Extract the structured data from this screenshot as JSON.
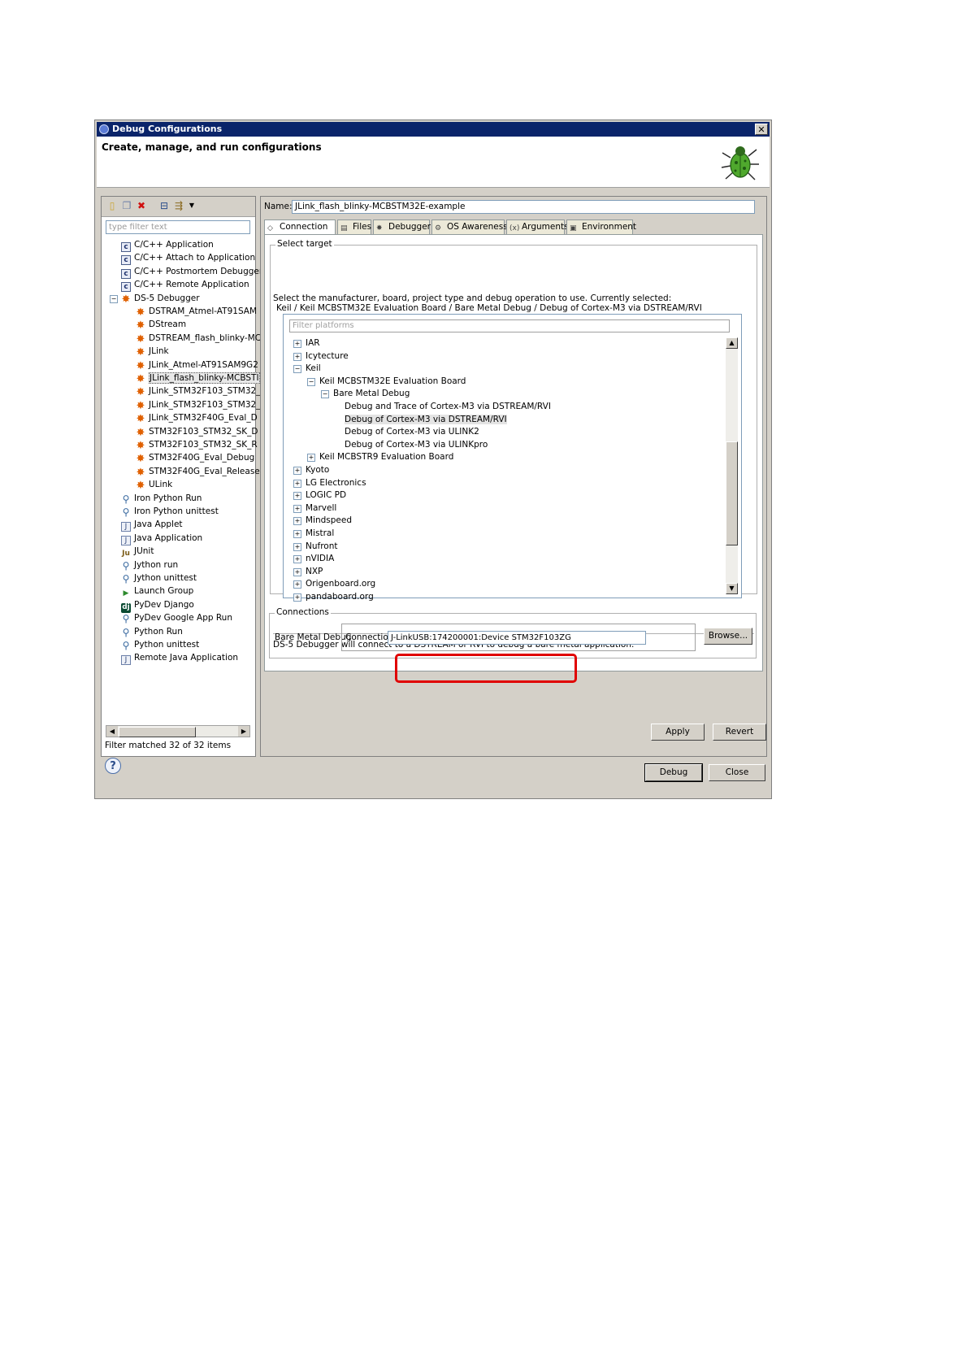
{
  "window": {
    "title": "Debug Configurations",
    "close_label": "✕"
  },
  "header": {
    "title": "Create, manage, and run configurations"
  },
  "left": {
    "filter_placeholder": "type filter text",
    "items": [
      {
        "label": "C/C++ Application",
        "icon": "c-app-icon",
        "glyph": "c",
        "level": 1
      },
      {
        "label": "C/C++ Attach to Application",
        "icon": "c-attach-icon",
        "glyph": "c",
        "level": 1
      },
      {
        "label": "C/C++ Postmortem Debugger",
        "icon": "c-postmortem-icon",
        "glyph": "c",
        "level": 1
      },
      {
        "label": "C/C++ Remote Application",
        "icon": "c-remote-icon",
        "glyph": "c",
        "level": 1
      },
      {
        "label": "DS-5 Debugger",
        "icon": "ds5-icon",
        "glyph": "ds",
        "level": 1,
        "expanded": true
      },
      {
        "label": "DSTRAM_Atmel-AT91SAM",
        "icon": "ds5-config-icon",
        "glyph": "ds",
        "level": 2
      },
      {
        "label": "DStream",
        "icon": "ds5-config-icon",
        "glyph": "ds",
        "level": 2
      },
      {
        "label": "DSTREAM_flash_blinky-MC",
        "icon": "ds5-config-icon",
        "glyph": "ds",
        "level": 2
      },
      {
        "label": "JLink",
        "icon": "ds5-config-icon",
        "glyph": "ds",
        "level": 2
      },
      {
        "label": "JLink_Atmel-AT91SAM9G2",
        "icon": "ds5-config-icon",
        "glyph": "ds",
        "level": 2
      },
      {
        "label": "JLink_flash_blinky-MCBSTI",
        "icon": "ds5-config-icon",
        "glyph": "ds",
        "level": 2,
        "selected": true
      },
      {
        "label": "JLink_STM32F103_STM32_",
        "icon": "ds5-config-icon",
        "glyph": "ds",
        "level": 2
      },
      {
        "label": "JLink_STM32F103_STM32_",
        "icon": "ds5-config-icon",
        "glyph": "ds",
        "level": 2
      },
      {
        "label": "JLink_STM32F40G_Eval_D",
        "icon": "ds5-config-icon",
        "glyph": "ds",
        "level": 2
      },
      {
        "label": "STM32F103_STM32_SK_D",
        "icon": "ds5-config-icon",
        "glyph": "ds",
        "level": 2
      },
      {
        "label": "STM32F103_STM32_SK_R",
        "icon": "ds5-config-icon",
        "glyph": "ds",
        "level": 2
      },
      {
        "label": "STM32F40G_Eval_Debug",
        "icon": "ds5-config-icon",
        "glyph": "ds",
        "level": 2
      },
      {
        "label": "STM32F40G_Eval_Release",
        "icon": "ds5-config-icon",
        "glyph": "ds",
        "level": 2
      },
      {
        "label": "ULink",
        "icon": "ds5-config-icon",
        "glyph": "ds",
        "level": 2
      },
      {
        "label": "Iron Python Run",
        "icon": "iron-python-icon",
        "glyph": "py",
        "level": 1
      },
      {
        "label": "Iron Python unittest",
        "icon": "iron-python-unittest-icon",
        "glyph": "py",
        "level": 1
      },
      {
        "label": "Java Applet",
        "icon": "java-applet-icon",
        "glyph": "java",
        "level": 1
      },
      {
        "label": "Java Application",
        "icon": "java-app-icon",
        "glyph": "java",
        "level": 1
      },
      {
        "label": "JUnit",
        "icon": "junit-icon",
        "glyph": "ju",
        "level": 1
      },
      {
        "label": "Jython run",
        "icon": "jython-icon",
        "glyph": "py",
        "level": 1
      },
      {
        "label": "Jython unittest",
        "icon": "jython-unittest-icon",
        "glyph": "py",
        "level": 1
      },
      {
        "label": "Launch Group",
        "icon": "launch-group-icon",
        "glyph": "launch",
        "level": 1
      },
      {
        "label": "PyDev Django",
        "icon": "django-icon",
        "glyph": "dj",
        "level": 1
      },
      {
        "label": "PyDev Google App Run",
        "icon": "google-app-icon",
        "glyph": "py",
        "level": 1
      },
      {
        "label": "Python Run",
        "icon": "python-icon",
        "glyph": "py",
        "level": 1
      },
      {
        "label": "Python unittest",
        "icon": "python-unittest-icon",
        "glyph": "py",
        "level": 1
      },
      {
        "label": "Remote Java Application",
        "icon": "remote-java-icon",
        "glyph": "java",
        "level": 1
      }
    ],
    "status": "Filter matched 32 of 32 items"
  },
  "right": {
    "name_label": "Name:",
    "name_value": "JLink_flash_blinky-MCBSTM32E-example",
    "tabs": [
      {
        "label": "Connection",
        "icon": "connection-icon",
        "active": true
      },
      {
        "label": "Files",
        "icon": "files-icon"
      },
      {
        "label": "Debugger",
        "icon": "debugger-icon"
      },
      {
        "label": "OS Awareness",
        "icon": "os-awareness-icon"
      },
      {
        "label": "Arguments",
        "icon": "arguments-icon"
      },
      {
        "label": "Environment",
        "icon": "environment-icon"
      }
    ],
    "select_target": {
      "legend": "Select target",
      "desc": "Select the manufacturer, board, project type and debug operation to use. Currently selected:",
      "current": "Keil / Keil MCBSTM32E Evaluation Board / Bare Metal Debug / Debug of Cortex-M3 via DSTREAM/RVI",
      "filter_placeholder": "Filter platforms",
      "tree": [
        {
          "label": "IAR",
          "exp": "+",
          "level": 0
        },
        {
          "label": "Icytecture",
          "exp": "+",
          "level": 0
        },
        {
          "label": "Keil",
          "exp": "−",
          "level": 0
        },
        {
          "label": "Keil MCBSTM32E Evaluation Board",
          "exp": "−",
          "level": 1
        },
        {
          "label": "Bare Metal Debug",
          "exp": "−",
          "level": 2
        },
        {
          "label": "Debug and Trace of Cortex-M3 via DSTREAM/RVI",
          "exp": "",
          "level": 3
        },
        {
          "label": "Debug of Cortex-M3 via DSTREAM/RVI",
          "exp": "",
          "level": 3,
          "selected": true
        },
        {
          "label": "Debug of Cortex-M3 via ULINK2",
          "exp": "",
          "level": 3
        },
        {
          "label": "Debug of Cortex-M3 via ULINKpro",
          "exp": "",
          "level": 3
        },
        {
          "label": "Keil MCBSTR9 Evaluation Board",
          "exp": "+",
          "level": 1
        },
        {
          "label": "Kyoto",
          "exp": "+",
          "level": 0
        },
        {
          "label": "LG Electronics",
          "exp": "+",
          "level": 0
        },
        {
          "label": "LOGIC PD",
          "exp": "+",
          "level": 0
        },
        {
          "label": "Marvell",
          "exp": "+",
          "level": 0
        },
        {
          "label": "Mindspeed",
          "exp": "+",
          "level": 0
        },
        {
          "label": "Mistral",
          "exp": "+",
          "level": 0
        },
        {
          "label": "Nufront",
          "exp": "+",
          "level": 0
        },
        {
          "label": "nVIDIA",
          "exp": "+",
          "level": 0
        },
        {
          "label": "NXP",
          "exp": "+",
          "level": 0
        },
        {
          "label": "Origenboard.org",
          "exp": "+",
          "level": 0
        },
        {
          "label": "pandaboard.org",
          "exp": "+",
          "level": 0
        }
      ],
      "info": "DS-5 Debugger will connect to a DSTREAM or RVI to debug a bare metal application."
    },
    "connections": {
      "legend": "Connections",
      "type_label": "Bare Metal Debug",
      "conn_label": "Connection",
      "conn_value": "J-LinkUSB:174200001:Device STM32F103ZG",
      "browse": "Browse..."
    },
    "apply": "Apply",
    "revert": "Revert"
  },
  "footer": {
    "help": "?",
    "debug": "Debug",
    "close": "Close"
  },
  "colors": {
    "highlight": "#e00000",
    "titlebar": "#0a246a"
  }
}
